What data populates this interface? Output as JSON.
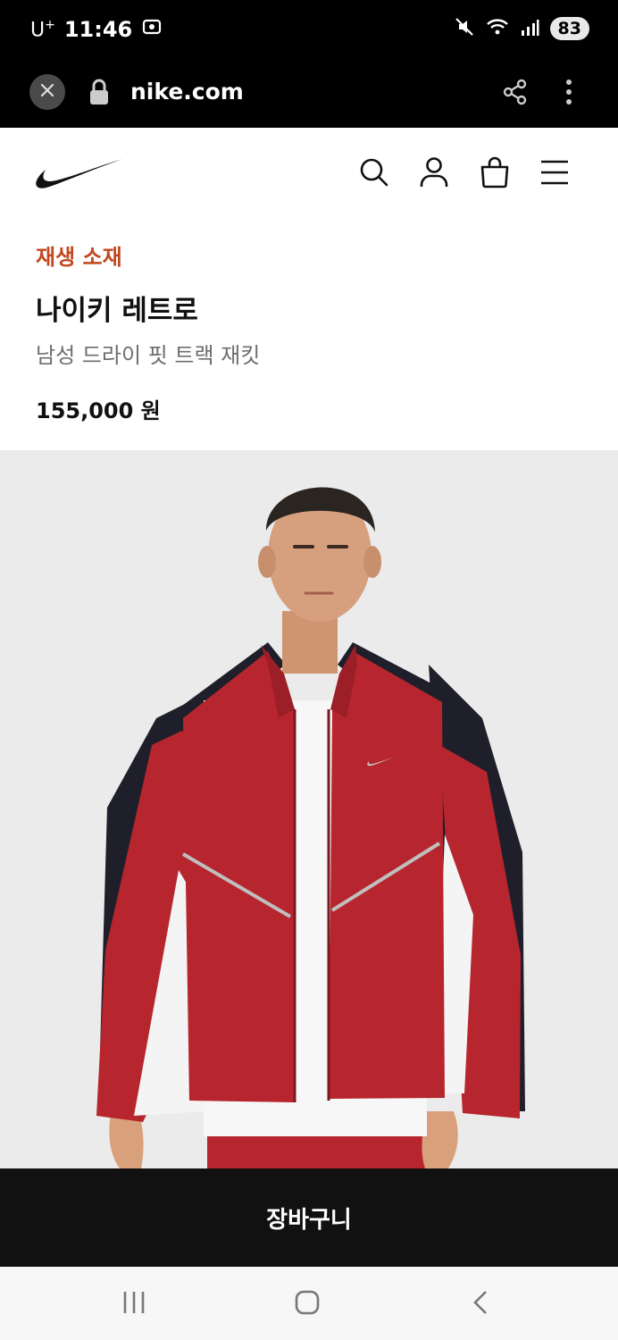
{
  "status": {
    "carrier": "U",
    "carrier_sup": "+",
    "time": "11:46",
    "battery": "83"
  },
  "browser": {
    "url": "nike.com"
  },
  "product": {
    "badge": "재생 소재",
    "title": "나이키 레트로",
    "subtitle": "남성 드라이 핏 트랙 재킷",
    "price": "155,000 원"
  },
  "cart": {
    "label": "장바구니"
  },
  "colors": {
    "badge": "#c2481f",
    "jacket": "#b7262e",
    "cart_bar": "#111111"
  },
  "icons": {
    "header": [
      "search-icon",
      "user-icon",
      "bag-icon",
      "menu-icon"
    ],
    "browser": [
      "close-icon",
      "lock-icon",
      "share-icon",
      "more-icon"
    ],
    "nav": [
      "recents-icon",
      "home-icon",
      "back-icon"
    ]
  }
}
